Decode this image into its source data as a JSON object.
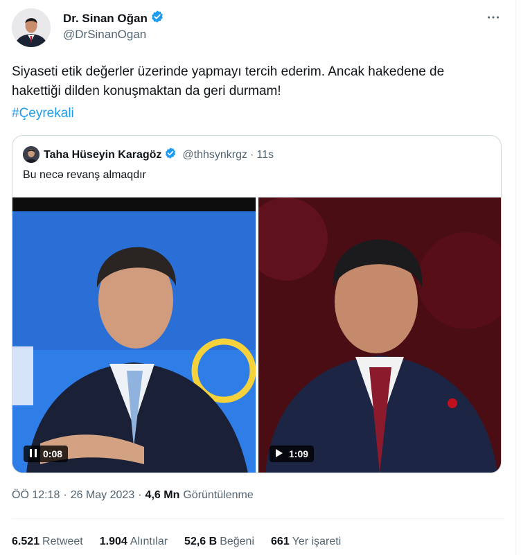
{
  "author": {
    "name": "Dr. Sinan Oğan",
    "handle": "@DrSinanOgan"
  },
  "tweet": {
    "text": "Siyaseti etik değerler üzerinde yapmayı tercih ederim. Ancak hakedene de hakettiği dilden konuşmaktan da geri durmam!",
    "hashtag": "#Çeyrekali"
  },
  "quoted": {
    "name": "Taha Hüseyin Karagöz",
    "handle": "@thhsynkrgz",
    "separator": "·",
    "time": "11s",
    "text": "Bu necə revanş almaqdır",
    "videos": [
      {
        "state": "playing",
        "time": "0:08"
      },
      {
        "state": "paused",
        "time": "1:09"
      }
    ]
  },
  "meta": {
    "time": "ÖÖ 12:18",
    "dot1": "·",
    "date": "26 May 2023",
    "dot2": "·",
    "views_count": "4,6 Mn",
    "views_label": "Görüntülenme"
  },
  "stats": {
    "retweets_count": "6.521",
    "retweets_label": "Retweet",
    "quotes_count": "1.904",
    "quotes_label": "Alıntılar",
    "likes_count": "52,6 B",
    "likes_label": "Beğeni",
    "bookmarks_count": "661",
    "bookmarks_label": "Yer işareti"
  },
  "colors": {
    "accent": "#1d9bf0",
    "verified": "#1d9bf0",
    "text_primary": "#0f1419",
    "text_secondary": "#536471",
    "border": "#cfd9de"
  },
  "icons": [
    "verified-badge-icon",
    "more-options-icon",
    "pause-icon",
    "play-icon"
  ]
}
